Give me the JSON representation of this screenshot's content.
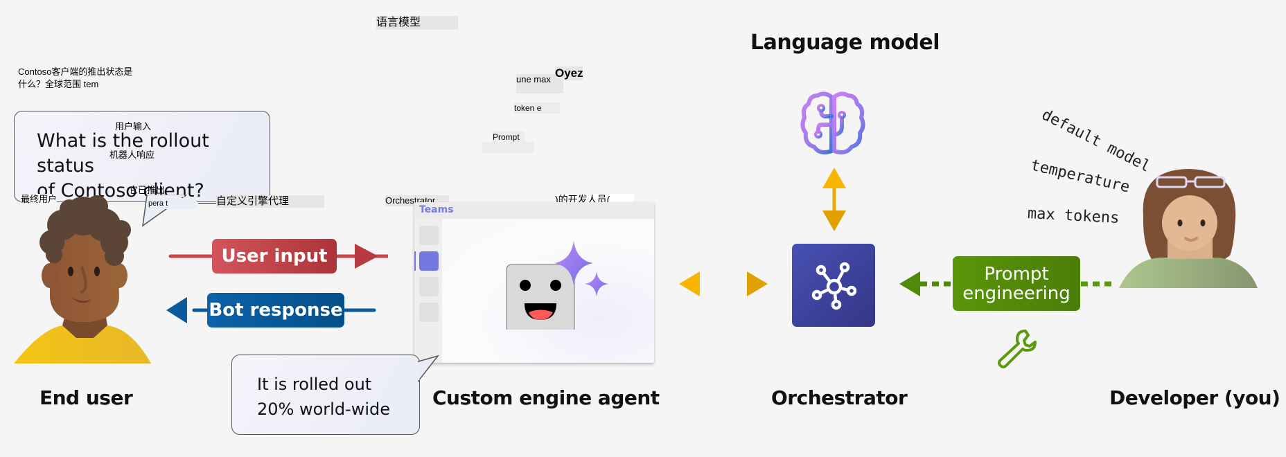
{
  "overlay_text": {
    "lang_model_cn": "语言模型",
    "question_cn_line1": "Contoso客户端的推出状态是",
    "question_cn_line2": "什么？全球范围 tem",
    "user_input_cn": "用户输入",
    "bot_response_cn": "机器人响应",
    "rolled_out_cn": "它已推出",
    "end_user_cn": "最终用户",
    "pera_t": "pera t",
    "custom_engine_agent_cn": "自定义引擎代理",
    "orchestrator_small": "Orchestrator",
    "developer_cn": ")的开发人员(",
    "une_max": "une max",
    "oyez": "Oyez",
    "token_e": "token e",
    "prompt_small": "Prompt"
  },
  "user_bubble": {
    "line1": "What is the rollout status",
    "line2": "of Contoso client?"
  },
  "bot_bubble": {
    "line1": "It is rolled out",
    "line2": "20% world-wide"
  },
  "pills": {
    "user_input": "User input",
    "bot_response": "Bot response",
    "prompt_engineering_line1": "Prompt",
    "prompt_engineering_line2": "engineering"
  },
  "teams": {
    "label": "Teams"
  },
  "settings": {
    "default_model": "default model",
    "temperature": "temperature",
    "max_tokens": "max tokens"
  },
  "labels": {
    "end_user": "End user",
    "custom_engine_agent": "Custom engine agent",
    "orchestrator": "Orchestrator",
    "developer": "Developer (you)",
    "language_model": "Language model"
  },
  "colors": {
    "user_input": "#c9464d",
    "bot_response": "#0a5a9c",
    "prompt_engineering": "#4f8a0b",
    "orchestrator": "#3f449f",
    "exchange_arrow": "#eeb000",
    "teams_accent": "#7a7de0"
  }
}
